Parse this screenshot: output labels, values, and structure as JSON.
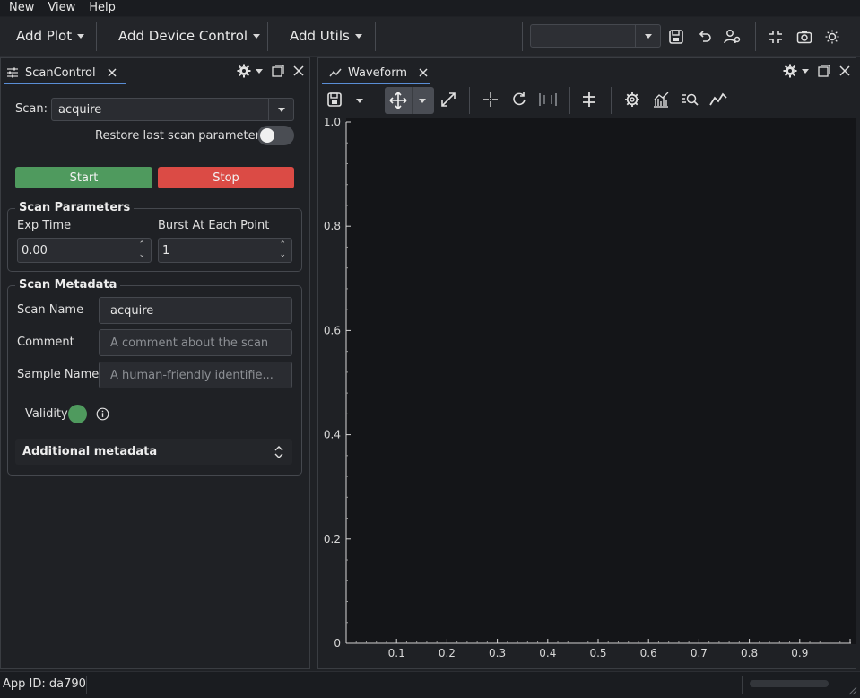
{
  "menu": [
    "New",
    "View",
    "Help"
  ],
  "toolbar": {
    "add_plot": "Add Plot",
    "add_device_control": "Add Device Control",
    "add_utils": "Add Utils",
    "profile_combo_value": "",
    "icons": [
      "save-icon",
      "undo-icon",
      "user-settings-icon",
      "collapse-icon",
      "camera-icon",
      "theme-sun-icon"
    ]
  },
  "scan_dock": {
    "tab_label": "ScanControl",
    "scan_label": "Scan:",
    "scan_value": "acquire",
    "restore_label": "Restore last scan parameters",
    "restore_on": false,
    "start_label": "Start",
    "stop_label": "Stop",
    "params": {
      "title": "Scan Parameters",
      "exp_time_label": "Exp Time",
      "exp_time_value": "0.00",
      "burst_label": "Burst At Each Point",
      "burst_value": "1"
    },
    "metadata": {
      "title": "Scan Metadata",
      "scan_name_label": "Scan Name",
      "scan_name_value": "acquire",
      "comment_label": "Comment",
      "comment_placeholder": "A comment about the scan",
      "sample_name_label": "Sample Name",
      "sample_name_placeholder": "A human-friendly identifie...",
      "validity_label": "Validity",
      "validity_color": "#4f9a5e",
      "additional_label": "Additional metadata"
    }
  },
  "waveform_dock": {
    "tab_label": "Waveform"
  },
  "chart_data": {
    "type": "line",
    "title": "",
    "xlabel": "",
    "ylabel": "",
    "xlim": [
      0,
      1
    ],
    "ylim": [
      0,
      1
    ],
    "x_ticks": [
      "0.1",
      "0.2",
      "0.3",
      "0.4",
      "0.5",
      "0.6",
      "0.7",
      "0.8",
      "0.9"
    ],
    "y_ticks": [
      "0",
      "0.2",
      "0.4",
      "0.6",
      "0.8",
      "1.0"
    ],
    "series": []
  },
  "status": {
    "app_id": "App ID: da790"
  }
}
